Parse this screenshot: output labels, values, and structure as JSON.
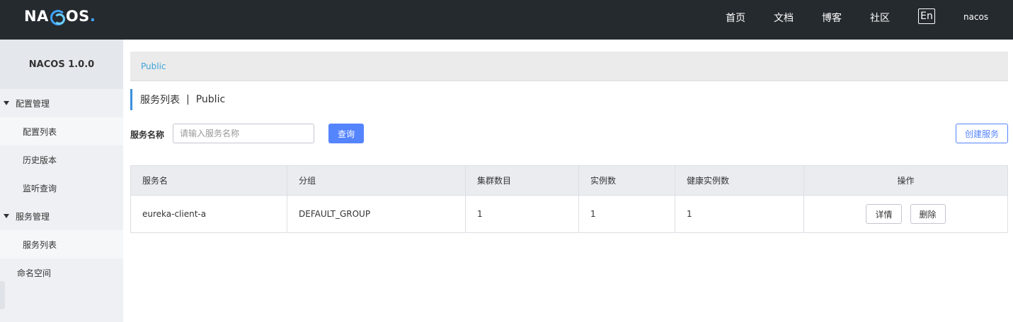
{
  "topbar": {
    "logo_text_a": "NA",
    "logo_text_b": "OS",
    "logo_dot": ".",
    "nav": [
      "首页",
      "文档",
      "博客",
      "社区"
    ],
    "lang": "En",
    "user": "nacos",
    "bg_color": "#252a2f",
    "accent": "#3fa5ff"
  },
  "sidebar": {
    "title": "NACOS 1.0.0",
    "groups": [
      {
        "label": "配置管理",
        "items": [
          "配置列表",
          "历史版本",
          "监听查询"
        ]
      },
      {
        "label": "服务管理",
        "items": [
          "服务列表"
        ]
      }
    ],
    "plain_item": "命名空间"
  },
  "main": {
    "breadcrumb": "Public",
    "title": "服务列表",
    "title_sep": "|",
    "title_ns": "Public",
    "search": {
      "label": "服务名称",
      "placeholder": "请输入服务名称",
      "value": "",
      "query_label": "查询",
      "create_label": "创建服务"
    },
    "table": {
      "headers": [
        "服务名",
        "分组",
        "集群数目",
        "实例数",
        "健康实例数",
        "操作"
      ],
      "rows": [
        {
          "name": "eureka-client-a",
          "group": "DEFAULT_GROUP",
          "clusters": "1",
          "instances": "1",
          "healthy": "1",
          "ops": [
            "详情",
            "删除"
          ]
        }
      ]
    },
    "primary_color": "#5584ff"
  }
}
